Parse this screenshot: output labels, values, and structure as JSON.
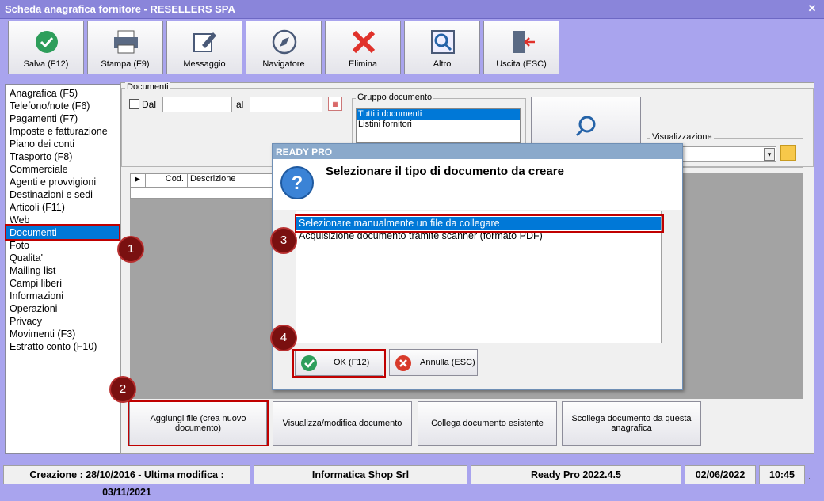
{
  "window": {
    "title": "Scheda anagrafica fornitore - RESELLERS SPA"
  },
  "toolbar": [
    {
      "label": "Salva (F12)",
      "icon": "check-icon"
    },
    {
      "label": "Stampa (F9)",
      "icon": "printer-icon"
    },
    {
      "label": "Messaggio",
      "icon": "message-edit-icon"
    },
    {
      "label": "Navigatore",
      "icon": "compass-icon"
    },
    {
      "label": "Elimina",
      "icon": "delete-x-icon"
    },
    {
      "label": "Altro",
      "icon": "magnifier-icon"
    },
    {
      "label": "Uscita (ESC)",
      "icon": "exit-door-icon"
    }
  ],
  "sidebar": {
    "items": [
      "Anagrafica (F5)",
      "Telefono/note (F6)",
      "Pagamenti (F7)",
      "Imposte e fatturazione",
      "Piano dei conti",
      "Trasporto (F8)",
      "Commerciale",
      "Agenti e provvigioni",
      "Destinazioni e sedi",
      "Articoli (F11)",
      "Web",
      "Documenti",
      "Foto",
      "Qualita'",
      "Mailing list",
      "Campi liberi",
      "Informazioni",
      "Operazioni",
      "Privacy",
      "Movimenti (F3)",
      "Estratto conto (F10)"
    ],
    "selected": "Documenti"
  },
  "documents": {
    "legend": "Documenti",
    "dal_label": "Dal",
    "al_label": "al",
    "group_legend": "Gruppo documento",
    "group_items": [
      "Tutti i documenti",
      "Listini fornitori"
    ],
    "visual_legend": "Visualizzazione",
    "grid_cols": [
      "Cod.",
      "Descrizione"
    ]
  },
  "bottom_buttons": [
    "Aggiungi file (crea nuovo documento)",
    "Visualizza/modifica documento",
    "Collega documento esistente",
    "Scollega documento da questa anagrafica"
  ],
  "dialog": {
    "title": "READY PRO",
    "heading": "Selezionare il tipo di documento da creare",
    "options": [
      "Selezionare manualmente un file da collegare",
      "Acquisizione documento tramite scanner (formato PDF)"
    ],
    "ok_label": "OK (F12)",
    "cancel_label": "Annulla (ESC)"
  },
  "badges": [
    "1",
    "2",
    "3",
    "4"
  ],
  "status": {
    "dates": "Creazione : 28/10/2016 - Ultima modifica : 03/11/2021",
    "company": "Informatica Shop Srl",
    "version": "Ready Pro 2022.4.5",
    "date": "02/06/2022",
    "time": "10:45"
  },
  "colors": {
    "accent": "#0078d7",
    "highlight": "#c00000",
    "window_bg": "#a9a4ee"
  }
}
